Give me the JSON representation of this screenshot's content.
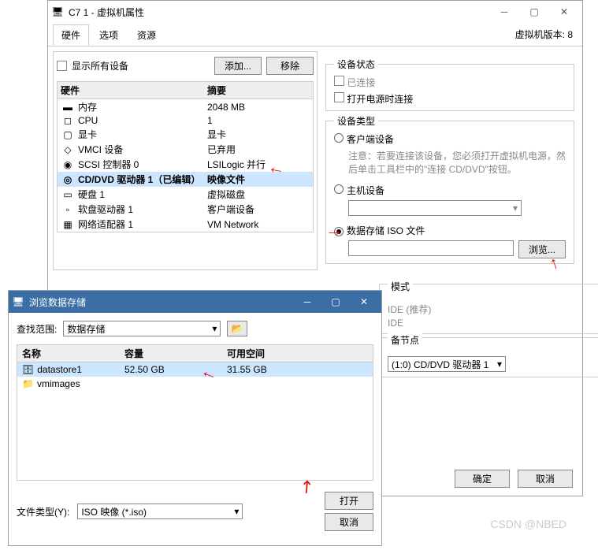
{
  "mainWin": {
    "title": "C7 1 - 虚拟机属性",
    "tabs": [
      "硬件",
      "选项",
      "资源"
    ],
    "vmVersion": "虚拟机版本: 8",
    "showAll": "显示所有设备",
    "addBtn": "添加...",
    "removeBtn": "移除",
    "colHw": "硬件",
    "colSum": "摘要",
    "rows": [
      {
        "icon": "▬",
        "name": "内存",
        "sum": "2048 MB"
      },
      {
        "icon": "◻",
        "name": "CPU",
        "sum": "1"
      },
      {
        "icon": "▢",
        "name": "显卡",
        "sum": "显卡"
      },
      {
        "icon": "◇",
        "name": "VMCI 设备",
        "sum": "已弃用"
      },
      {
        "icon": "◉",
        "name": "SCSI 控制器 0",
        "sum": "LSILogic 并行"
      },
      {
        "icon": "◎",
        "name": "CD/DVD 驱动器 1（已编辑）",
        "sum": "映像文件",
        "sel": true
      },
      {
        "icon": "▭",
        "name": "硬盘 1",
        "sum": "虚拟磁盘"
      },
      {
        "icon": "▫",
        "name": "软盘驱动器 1",
        "sum": "客户端设备"
      },
      {
        "icon": "▦",
        "name": "网络适配器 1",
        "sum": "VM Network"
      }
    ],
    "status": {
      "legend": "设备状态",
      "connected": "已连接",
      "connectOnPower": "打开电源时连接"
    },
    "devType": {
      "legend": "设备类型",
      "client": "客户端设备",
      "hint": "注意：若要连接该设备，您必须打开虚拟机电源，然后单击工具栏中的\"连接 CD/DVD\"按钮。",
      "host": "主机设备",
      "iso": "数据存储 ISO 文件",
      "browse": "浏览..."
    },
    "mode": {
      "legend": "模式",
      "rec": "IDE (推荐)",
      "ide": "IDE"
    },
    "vdev": {
      "legend": "备节点",
      "value": "(1:0) CD/DVD 驱动器 1"
    },
    "ok": "确定",
    "cancel": "取消"
  },
  "browseWin": {
    "title": "浏览数据存储",
    "scopeLabel": "查找范围:",
    "scopeValue": "数据存储",
    "colName": "名称",
    "colCap": "容量",
    "colFree": "可用空间",
    "rows": [
      {
        "icon": "🗄",
        "name": "datastore1",
        "cap": "52.50 GB",
        "free": "31.55 GB",
        "sel": true
      },
      {
        "icon": "📁",
        "name": "vmimages",
        "cap": "",
        "free": ""
      }
    ],
    "fileTypeLabel": "文件类型(Y):",
    "fileTypeValue": "ISO 映像 (*.iso)",
    "open": "打开",
    "cancel": "取消"
  },
  "watermark": "CSDN @NBED"
}
